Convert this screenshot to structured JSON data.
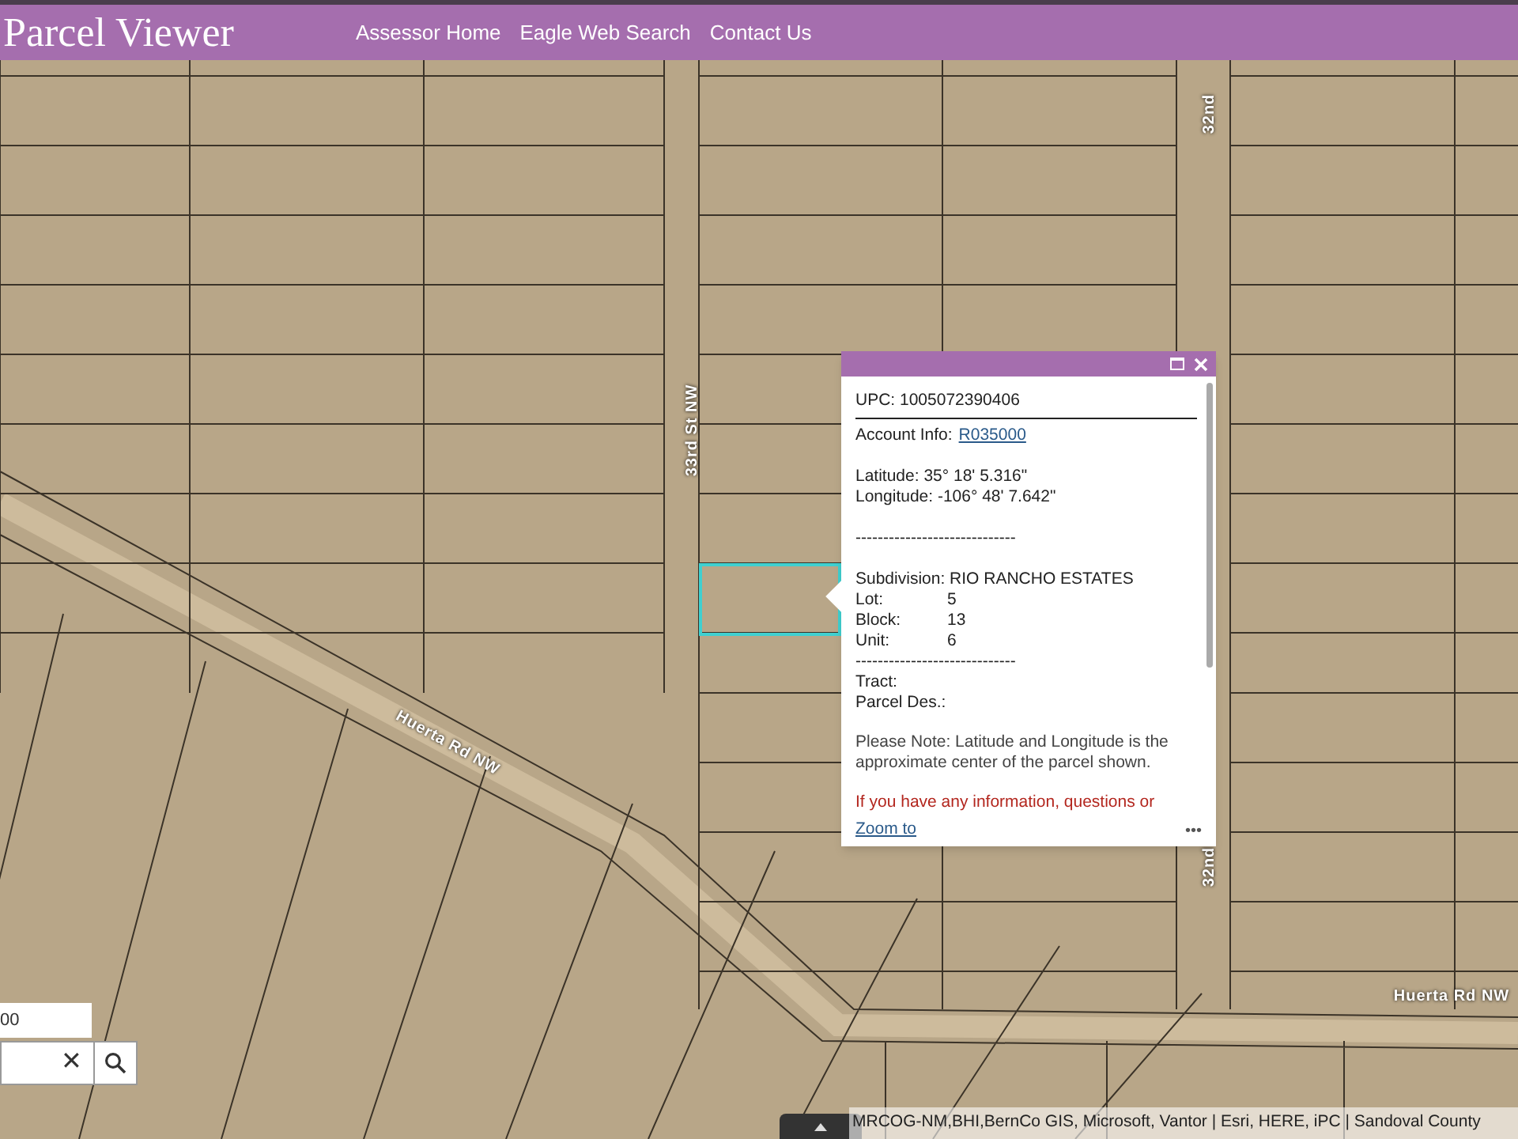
{
  "header": {
    "title": "Parcel Viewer",
    "nav_links": [
      {
        "label": "Assessor Home"
      },
      {
        "label": "Eagle Web Search"
      },
      {
        "label": "Contact Us"
      }
    ]
  },
  "map": {
    "road_labels": [
      {
        "text": "33rd St NW",
        "kind": "vertical"
      },
      {
        "text": "32nd",
        "kind": "vertical"
      },
      {
        "text": "32nd",
        "kind": "vertical"
      },
      {
        "text": "Huerta Rd NW",
        "kind": "diagonal"
      },
      {
        "text": "Huerta Rd NW",
        "kind": "horizontal"
      }
    ]
  },
  "popup": {
    "upc": "UPC: 1005072390406",
    "account_label": "Account Info:",
    "account_link": "R035000",
    "latitude": "Latitude: 35° 18' 5.316\"",
    "longitude": "Longitude: -106° 48' 7.642\"",
    "separator": "-----------------------------",
    "subdivision": "Subdivision: RIO RANCHO ESTATES",
    "fields": [
      {
        "label": "Lot:",
        "value": "5"
      },
      {
        "label": "Block:",
        "value": "13"
      },
      {
        "label": "Unit:",
        "value": "6"
      }
    ],
    "separator_2": "-----------------------------",
    "tract": "Tract:",
    "parcel_des": "Parcel Des.:",
    "note": "Please Note: Latitude and Longitude is the approximate center of the parcel shown.",
    "warning": "If you have any information, questions or",
    "zoom_link": "Zoom to",
    "more": "•••"
  },
  "scale_field": {
    "value": "00"
  },
  "search": {
    "clear": "✕"
  },
  "attribution": "MRCOG-NM,BHI,BernCo GIS, Microsoft, Vantor | Esri, HERE, iPC | Sandoval County"
}
